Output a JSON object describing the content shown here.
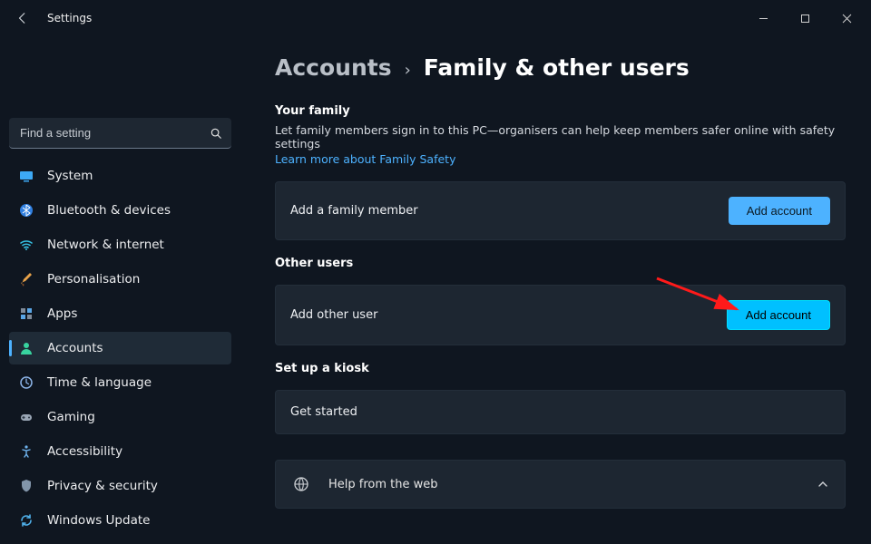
{
  "window": {
    "title": "Settings"
  },
  "search": {
    "placeholder": "Find a setting"
  },
  "sidebar": {
    "items": [
      {
        "label": "System"
      },
      {
        "label": "Bluetooth & devices"
      },
      {
        "label": "Network & internet"
      },
      {
        "label": "Personalisation"
      },
      {
        "label": "Apps"
      },
      {
        "label": "Accounts"
      },
      {
        "label": "Time & language"
      },
      {
        "label": "Gaming"
      },
      {
        "label": "Accessibility"
      },
      {
        "label": "Privacy & security"
      },
      {
        "label": "Windows Update"
      }
    ],
    "active_index": 5
  },
  "breadcrumb": {
    "parent": "Accounts",
    "current": "Family & other users"
  },
  "family": {
    "heading": "Your family",
    "description": "Let family members sign in to this PC—organisers can help keep members safer online with safety settings",
    "link": "Learn more about Family Safety",
    "card_label": "Add a family member",
    "button": "Add account"
  },
  "other": {
    "heading": "Other users",
    "card_label": "Add other user",
    "button": "Add account"
  },
  "kiosk": {
    "heading": "Set up a kiosk",
    "card_label": "Get started"
  },
  "help": {
    "label": "Help from the web"
  },
  "colors": {
    "accent": "#4db2ff"
  }
}
